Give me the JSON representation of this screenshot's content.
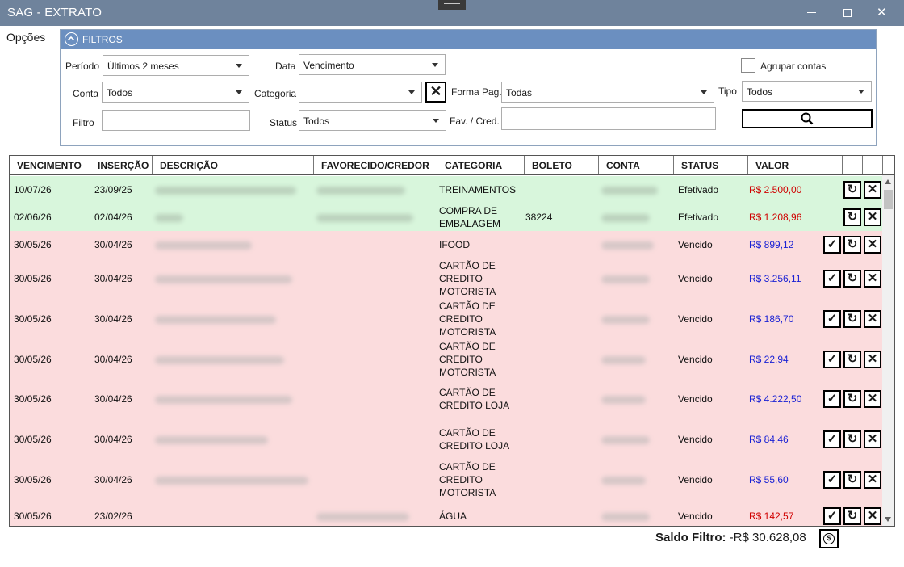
{
  "window": {
    "title": "SAG - EXTRATO",
    "minimize": "—",
    "maximize": "☐",
    "close": "✕"
  },
  "menu": {
    "opcoes": "Opções"
  },
  "filtros": {
    "header": "FILTROS",
    "periodo": {
      "label": "Período",
      "value": "Últimos 2 meses"
    },
    "data": {
      "label": "Data",
      "value": "Vencimento"
    },
    "agrupar": {
      "label": "Agrupar contas",
      "checked": false
    },
    "conta": {
      "label": "Conta",
      "value": "Todos"
    },
    "categoria": {
      "label": "Categoria",
      "value": ""
    },
    "forma_pag": {
      "label": "Forma Pag.",
      "value": "Todas"
    },
    "tipo": {
      "label": "Tipo",
      "value": "Todos"
    },
    "filtro": {
      "label": "Filtro",
      "value": ""
    },
    "status": {
      "label": "Status",
      "value": "Todos"
    },
    "fav_cred": {
      "label": "Fav. / Cred.",
      "value": ""
    }
  },
  "grid": {
    "columns": [
      "VENCIMENTO",
      "INSERÇÃO",
      "DESCRIÇÃO",
      "FAVORECIDO/CREDOR",
      "CATEGORIA",
      "BOLETO",
      "CONTA",
      "STATUS",
      "VALOR"
    ],
    "rows": [
      {
        "vencimento": "10/07/26",
        "insercao": "23/09/25",
        "categoria": "TREINAMENTOS",
        "boleto": "",
        "status": "Efetivado",
        "valor": "R$ 2.500,00",
        "tone": "ok",
        "val_color": "red"
      },
      {
        "vencimento": "02/06/26",
        "insercao": "02/04/26",
        "categoria": "COMPRA DE\nEMBALAGEM",
        "boleto": "38224",
        "status": "Efetivado",
        "valor": "R$ 1.208,96",
        "tone": "ok",
        "val_color": "red"
      },
      {
        "vencimento": "30/05/26",
        "insercao": "30/04/26",
        "categoria": "IFOOD",
        "boleto": "",
        "status": "Vencido",
        "valor": "R$ 899,12",
        "tone": "late",
        "val_color": "blue"
      },
      {
        "vencimento": "30/05/26",
        "insercao": "30/04/26",
        "categoria": "CARTÃO DE\nCREDITO\nMOTORISTA",
        "boleto": "",
        "status": "Vencido",
        "valor": "R$ 3.256,11",
        "tone": "late",
        "val_color": "blue"
      },
      {
        "vencimento": "30/05/26",
        "insercao": "30/04/26",
        "categoria": "CARTÃO DE\nCREDITO\nMOTORISTA",
        "boleto": "",
        "status": "Vencido",
        "valor": "R$ 186,70",
        "tone": "late",
        "val_color": "blue"
      },
      {
        "vencimento": "30/05/26",
        "insercao": "30/04/26",
        "categoria": "CARTÃO DE\nCREDITO\nMOTORISTA",
        "boleto": "",
        "status": "Vencido",
        "valor": "R$ 22,94",
        "tone": "late",
        "val_color": "blue"
      },
      {
        "vencimento": "30/05/26",
        "insercao": "30/04/26",
        "categoria": "CARTÃO DE\nCREDITO LOJA",
        "boleto": "",
        "status": "Vencido",
        "valor": "R$ 4.222,50",
        "tone": "late",
        "val_color": "blue"
      },
      {
        "vencimento": "30/05/26",
        "insercao": "30/04/26",
        "categoria": "CARTÃO DE\nCREDITO LOJA",
        "boleto": "",
        "status": "Vencido",
        "valor": "R$ 84,46",
        "tone": "late",
        "val_color": "blue"
      },
      {
        "vencimento": "30/05/26",
        "insercao": "30/04/26",
        "categoria": "CARTÃO DE\nCREDITO\nMOTORISTA",
        "boleto": "",
        "status": "Vencido",
        "valor": "R$ 55,60",
        "tone": "late",
        "val_color": "blue"
      },
      {
        "vencimento": "30/05/26",
        "insercao": "23/02/26",
        "categoria": "ÁGUA",
        "boleto": "",
        "status": "Vencido",
        "valor": "R$ 142,57",
        "tone": "late",
        "val_color": "red"
      }
    ]
  },
  "footer": {
    "saldo_label": "Saldo Filtro:",
    "saldo_value": "-R$ 30.628,08"
  },
  "colors": {
    "ok_row": "#d8f6dc",
    "late_row": "#fbdcdd",
    "value_red": "#d00000",
    "value_blue": "#1a22d4",
    "header_blue": "#6b8fc0",
    "titlebar": "#6f839c"
  }
}
